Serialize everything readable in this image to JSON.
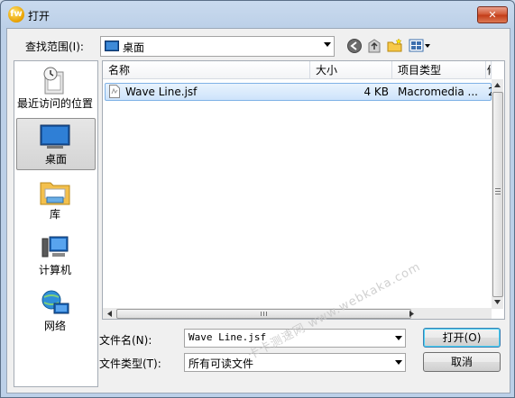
{
  "window": {
    "title": "打开",
    "app_icon_text": "fw",
    "close_glyph": "✕"
  },
  "lookin": {
    "label": "查找范围(I):",
    "value": "桌面"
  },
  "places": [
    {
      "label": "最近访问的位置",
      "icon": "recent-places-icon"
    },
    {
      "label": "桌面",
      "icon": "desktop-icon",
      "selected": true
    },
    {
      "label": "库",
      "icon": "library-icon"
    },
    {
      "label": "计算机",
      "icon": "computer-icon"
    },
    {
      "label": "网络",
      "icon": "network-icon"
    }
  ],
  "columns": [
    "名称",
    "大小",
    "项目类型",
    "修"
  ],
  "files": [
    {
      "name": "Wave Line.jsf",
      "size": "4 KB",
      "type": "Macromedia ...",
      "modified": "2"
    }
  ],
  "filename": {
    "label": "文件名(N):",
    "value": "Wave Line.jsf"
  },
  "filetype": {
    "label": "文件类型(T):",
    "value": "所有可读文件"
  },
  "buttons": {
    "open": "打开(O)",
    "cancel": "取消"
  },
  "watermark": "卡卡测速网 www.webkaka.com"
}
